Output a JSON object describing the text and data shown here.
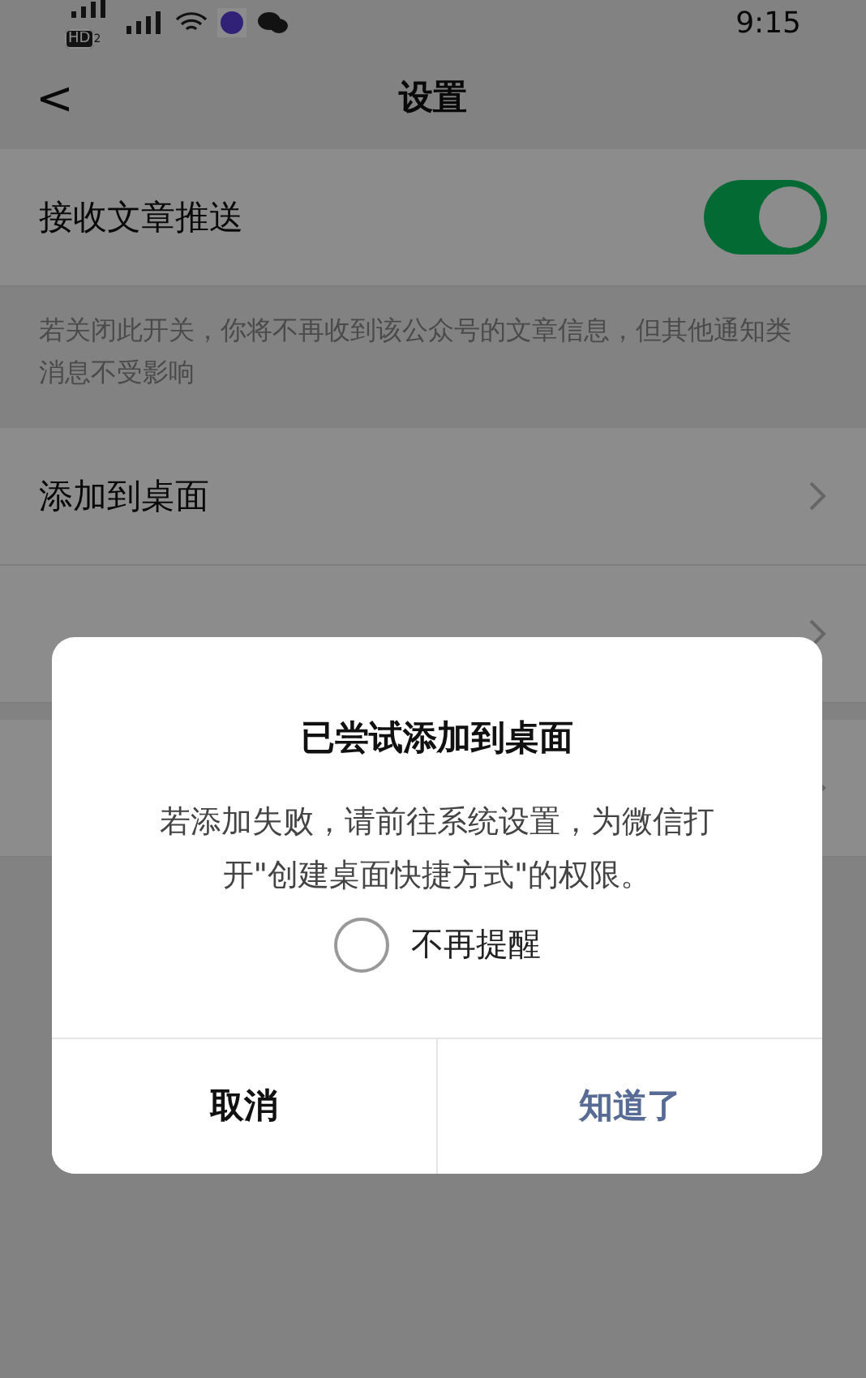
{
  "status_bar": {
    "hd_badge": "HD",
    "sim_index": "2",
    "time": "9:15"
  },
  "header": {
    "back": "<",
    "title": "设置"
  },
  "settings": [
    {
      "kind": "toggle",
      "label": "接收文章推送",
      "on": true
    },
    {
      "kind": "hint",
      "text": "若关闭此开关，你将不再收到该公众号的文章信息，但其他通知类消息不受影响"
    },
    {
      "kind": "link",
      "label": "添加到桌面"
    },
    {
      "kind": "link"
    },
    {
      "kind": "gap"
    },
    {
      "kind": "link"
    }
  ],
  "dialog": {
    "title": "已尝试添加到桌面",
    "message": "若添加失败，请前往系统设置，为微信打开\"创建桌面快捷方式\"的权限。",
    "checkbox": {
      "label": "不再提醒",
      "checked": false
    },
    "buttons": [
      {
        "label": "取消",
        "kind": "cancel"
      },
      {
        "label": "知道了",
        "kind": "confirm"
      }
    ]
  }
}
